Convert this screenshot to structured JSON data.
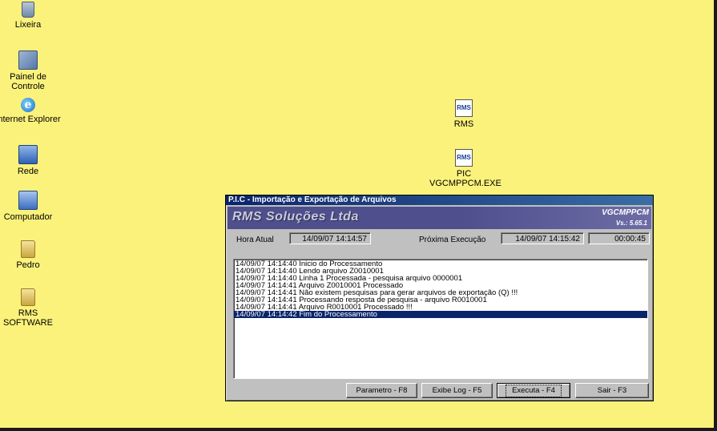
{
  "desktop": {
    "icons": [
      {
        "label": "Lixeira",
        "glyph": "recycle-bin-icon"
      },
      {
        "label": "Painel de Controle",
        "glyph": "control-panel-icon"
      },
      {
        "label": "Internet Explorer",
        "glyph": "internet-explorer-icon"
      },
      {
        "label": "Rede",
        "glyph": "network-icon"
      },
      {
        "label": "Computador",
        "glyph": "computer-icon"
      },
      {
        "label": "Pedro",
        "glyph": "user-folder-icon"
      },
      {
        "label": "RMS SOFTWARE",
        "glyph": "folder-icon"
      },
      {
        "label": "RMS",
        "glyph": "rms-app-icon"
      },
      {
        "label1": "PIC",
        "label2": "VGCMPPCM.EXE",
        "glyph": "rms-app-icon"
      }
    ],
    "background_color": "#fbf27c"
  },
  "window": {
    "title": "P.I.C - Importação e Exportação de Arquivos",
    "company": "RMS Soluções Ltda",
    "program": "VGCMPPCM",
    "version": "Vs.: 5.65.1",
    "hora_atual_label": "Hora Atual",
    "hora_atual_value": "14/09/07 14:14:57",
    "proxima_label": "Próxima Execução",
    "proxima_value": "14/09/07 14:15:42",
    "countdown": "00:00:45",
    "log": [
      "14/09/07 14:14:40 Inicio do Processamento",
      "14/09/07 14:14:40 Lendo arquivo Z0010001",
      "14/09/07 14:14:40 Linha 1 Processada - pesquisa arquivo 0000001",
      "14/09/07 14:14:41 Arquivo Z0010001 Processado",
      "14/09/07 14:14:41 Não existem pesquisas para gerar arquivos de exportação (Q) !!!",
      "14/09/07 14:14:41 Processando resposta de pesquisa - arquivo R0010001",
      "14/09/07 14:14:41 Arquivo R0010001 Processado !!!",
      "14/09/07 14:14:42 Fim do Processamento"
    ],
    "buttons": {
      "parametro": "Parametro - F8",
      "exibe_log": "Exibe Log - F5",
      "executa": "Executa - F4",
      "sair": "Sair - F3"
    },
    "colors": {
      "titlebar": "#0a246a",
      "selection": "#0a246a",
      "banner": "#4f4f8e"
    }
  }
}
